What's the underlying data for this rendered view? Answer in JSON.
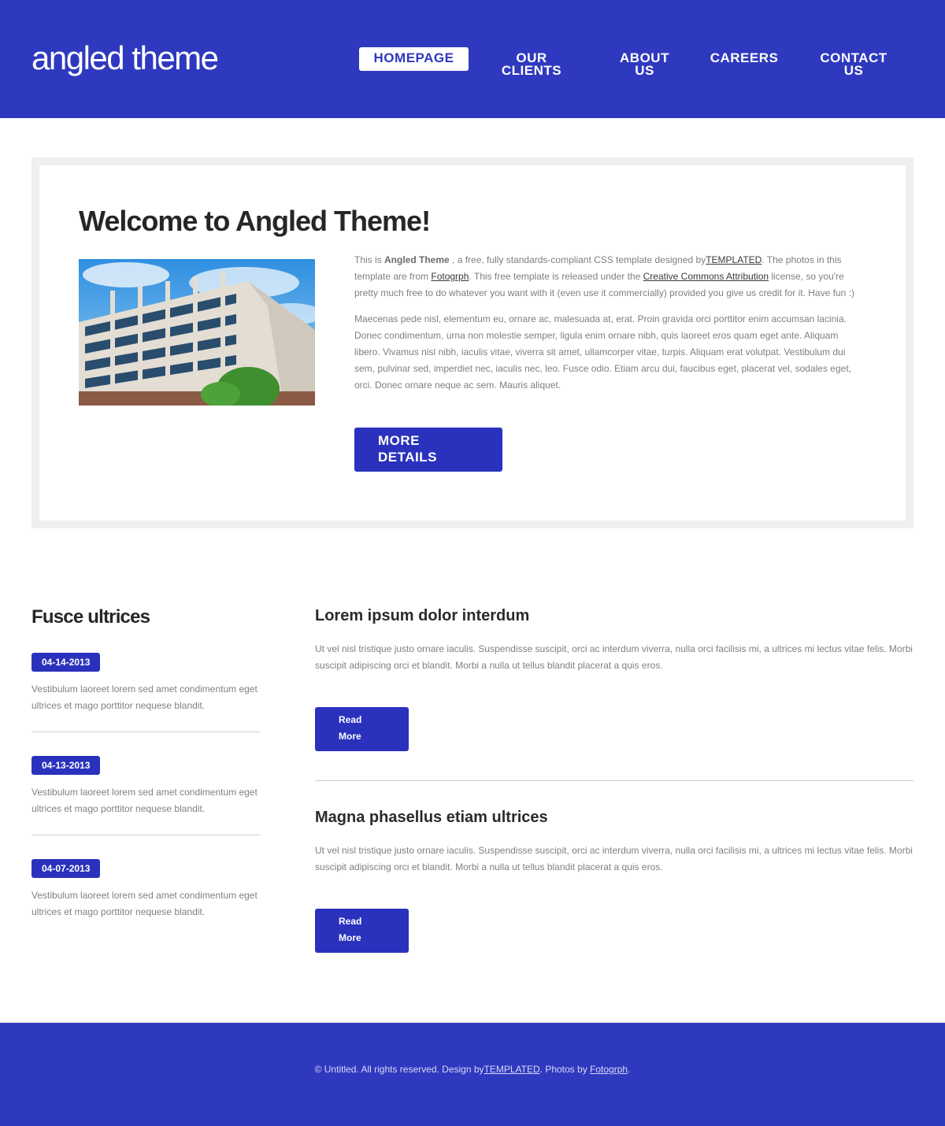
{
  "header": {
    "logo": "angled theme",
    "nav": [
      {
        "label": "HOMEPAGE",
        "active": true
      },
      {
        "label": "OUR CLIENTS",
        "active": false
      },
      {
        "label": "ABOUT US",
        "active": false
      },
      {
        "label": "CAREERS",
        "active": false
      },
      {
        "label": "CONTACT US",
        "active": false
      }
    ]
  },
  "welcome": {
    "title": "Welcome to Angled Theme!",
    "image_alt": "building-photo",
    "p1_a": "This is ",
    "p1_bold": "Angled Theme",
    "p1_b": " , a free, fully standards-compliant CSS template designed by",
    "p1_link1": "TEMPLATED",
    "p1_c": ". The photos in this template are from ",
    "p1_link2": "Fotogrph",
    "p1_d": ". This free template is released under the ",
    "p1_link3": "Creative Commons Attribution",
    "p1_e": " license, so you're pretty much free to do whatever you want with it (even use it commercially) provided you give us credit for it. Have fun :)",
    "p2": "Maecenas pede nisl, elementum eu, ornare ac, malesuada at, erat. Proin gravida orci porttitor enim accumsan lacinia. Donec condimentum, urna non molestie semper, ligula enim ornare nibh, quis laoreet eros quam eget ante. Aliquam libero. Vivamus nisl nibh, iaculis vitae, viverra sit amet, ullamcorper vitae, turpis. Aliquam erat volutpat. Vestibulum dui sem, pulvinar sed, imperdiet nec, iaculis nec, leo. Fusce odio. Etiam arcu dui, faucibus eget, placerat vel, sodales eget, orci. Donec ornare neque ac sem. Mauris aliquet.",
    "button_line1": "MORE",
    "button_line2": "DETAILS"
  },
  "sidebar": {
    "title": "Fusce ultrices",
    "entries": [
      {
        "date": "04-14-2013",
        "text": "Vestibulum laoreet lorem sed amet condimentum eget ultrices et mago porttitor nequese blandit."
      },
      {
        "date": "04-13-2013",
        "text": "Vestibulum laoreet lorem sed amet condimentum eget ultrices et mago porttitor nequese blandit."
      },
      {
        "date": "04-07-2013",
        "text": "Vestibulum laoreet lorem sed amet condimentum eget ultrices et mago porttitor nequese blandit."
      }
    ]
  },
  "articles": [
    {
      "title": "Lorem ipsum dolor interdum",
      "text": "Ut vel nisl tristique justo ornare iaculis. Suspendisse suscipit, orci ac interdum viverra, nulla orci facilisis mi, a ultrices mi lectus vitae felis. Morbi suscipit adipiscing orci et blandit. Morbi a nulla ut tellus blandit placerat a quis eros.",
      "button_line1": "Read",
      "button_line2": "More"
    },
    {
      "title": "Magna phasellus etiam ultrices",
      "text": "Ut vel nisl tristique justo ornare iaculis. Suspendisse suscipit, orci ac interdum viverra, nulla orci facilisis mi, a ultrices mi lectus vitae felis. Morbi suscipit adipiscing orci et blandit. Morbi a nulla ut tellus blandit placerat a quis eros.",
      "button_line1": "Read",
      "button_line2": "More"
    }
  ],
  "footer": {
    "a": "© Untitled. All rights reserved. Design by",
    "link1": "TEMPLATED",
    "b": ". Photos by ",
    "link2": "Fotogrph",
    "c": "."
  },
  "colors": {
    "brand": "#2f39bf",
    "button": "#2a32bd"
  }
}
